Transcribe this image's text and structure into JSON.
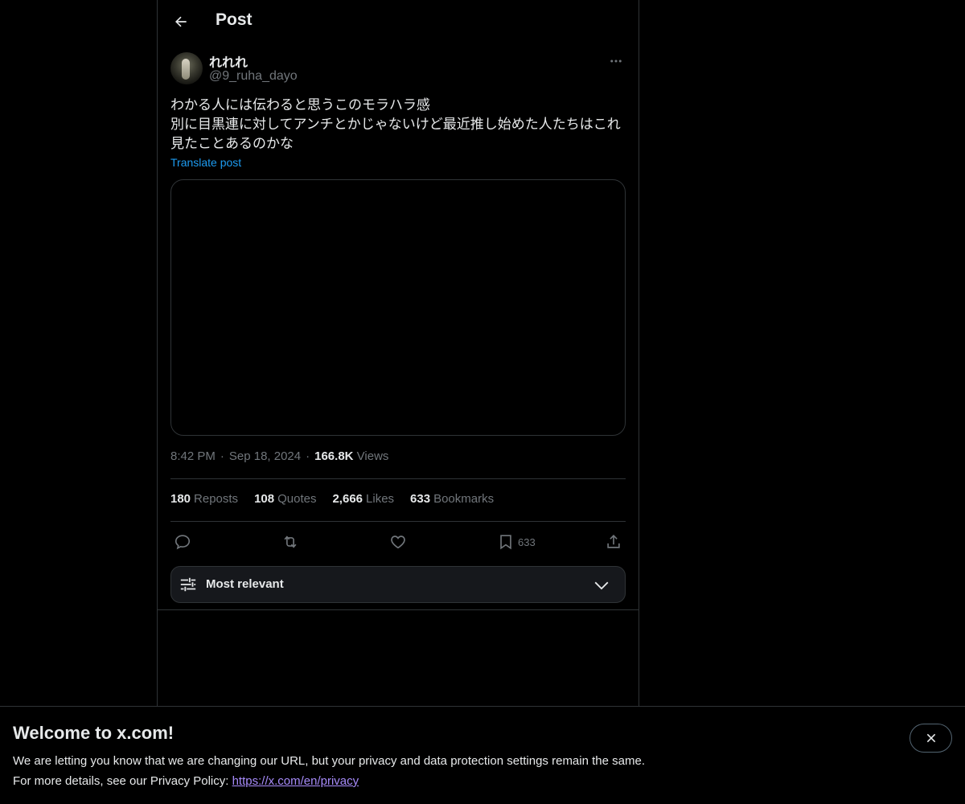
{
  "header": {
    "title": "Post"
  },
  "author": {
    "display_name": "れれれ",
    "handle": "@9_ruha_dayo"
  },
  "post": {
    "lines": [
      "わかる人には伝わると思うこのモラハラ感",
      "別に目黒連に対してアンチとかじゃないけど最近推し始めた人たちはこれ",
      "見たことあるのかな"
    ],
    "translate_label": "Translate post"
  },
  "meta": {
    "time": "8:42 PM",
    "separator": "·",
    "date": "Sep 18, 2024",
    "views_count": "166.8K",
    "views_label": "Views"
  },
  "stats": [
    {
      "num": "180",
      "label": "Reposts"
    },
    {
      "num": "108",
      "label": "Quotes"
    },
    {
      "num": "2,666",
      "label": "Likes"
    },
    {
      "num": "633",
      "label": "Bookmarks"
    }
  ],
  "actions": {
    "reply_icon": "reply-icon",
    "repost_icon": "repost-icon",
    "like_icon": "heart-icon",
    "bookmark_icon": "bookmark-icon",
    "bookmark_count": "633",
    "share_icon": "share-icon"
  },
  "sort": {
    "label": "Most relevant"
  },
  "banner": {
    "title": "Welcome to x.com!",
    "line1": "We are letting you know that we are changing our URL, but your privacy and data protection settings remain the same.",
    "line2_prefix": "For more details, see our Privacy Policy: ",
    "link": "https://x.com/en/privacy"
  },
  "colors": {
    "accent": "#1d9bf0",
    "background": "#000000",
    "muted": "#71767b",
    "border": "#2f3336",
    "link_visited": "#a78bfa"
  }
}
